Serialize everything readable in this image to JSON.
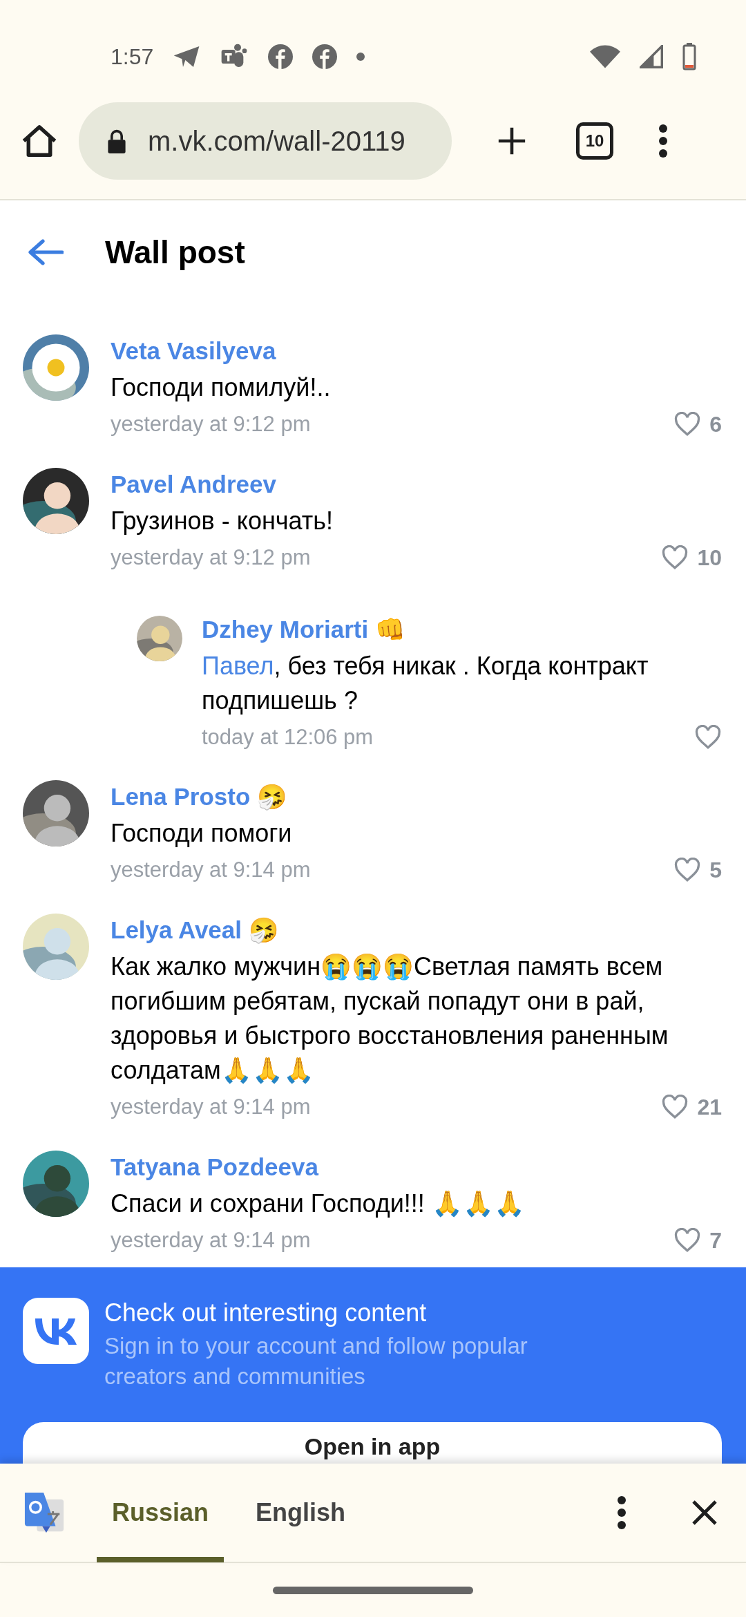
{
  "status_bar": {
    "time": "1:57"
  },
  "browser": {
    "url": "m.vk.com/wall-20119",
    "tab_count": "10"
  },
  "header": {
    "title": "Wall post"
  },
  "comments": [
    {
      "author": "Veta Vasilyeva",
      "avatar": {
        "kind": "picture"
      },
      "text": "Господи помилуй!..",
      "time": "yesterday at 9:12 pm",
      "likes": "6"
    },
    {
      "author": "Pavel Andreev",
      "avatar": {
        "kind": "picture"
      },
      "text": "Грузинов - кончать!",
      "time": "yesterday at 9:12 pm",
      "likes": "10",
      "replies": [
        {
          "author": "Dzhey Moriarti 👊",
          "avatar": {
            "kind": "picture"
          },
          "mention": "Павел",
          "text": ", без тебя никак . Когда контракт подпишешь ?",
          "time": "today at 12:06 pm"
        }
      ]
    },
    {
      "author": "Lena Prosto 🤧",
      "avatar": {
        "kind": "picture"
      },
      "text": "Господи помоги",
      "time": "yesterday at 9:14 pm",
      "likes": "5"
    },
    {
      "author": "Lelya Aveal 🤧",
      "avatar": {
        "kind": "picture"
      },
      "text": "Как жалко мужчин😭😭😭Светлая память всем погибшим ребятам, пускай попадут они в рай, здоровья и быстрого восстановления раненным солдатам🙏🙏🙏",
      "time": "yesterday at 9:14 pm",
      "likes": "21"
    },
    {
      "author": "Tatyana Pozdeeva",
      "avatar": {
        "kind": "picture"
      },
      "text": "Спаси и сохрани Господи!!! 🙏🙏🙏",
      "time": "yesterday at 9:14 pm",
      "likes": "7"
    }
  ],
  "banner": {
    "title": "Check out interesting content",
    "subtitle": "Sign in to your account and follow popular creators and communities",
    "button": "Open in app"
  },
  "translate_bar": {
    "languages": [
      {
        "label": "Russian",
        "selected": true
      },
      {
        "label": "English",
        "selected": false
      }
    ]
  }
}
